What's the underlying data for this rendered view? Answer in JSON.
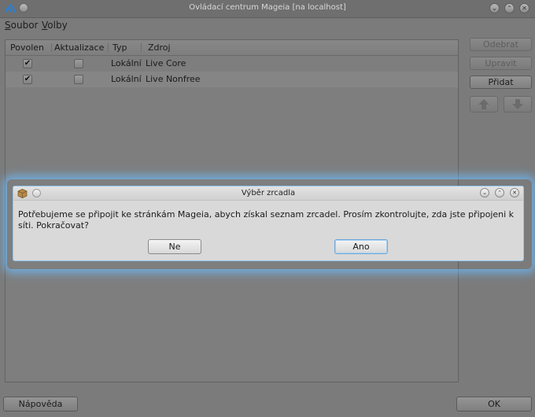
{
  "window": {
    "title": "Ovládací centrum Mageia  [na localhost]"
  },
  "menu": {
    "items": [
      {
        "first": "S",
        "rest": "oubor"
      },
      {
        "first": "V",
        "rest": "olby"
      }
    ]
  },
  "table": {
    "headers": [
      "Povolen",
      "Aktualizace",
      "Typ",
      "Zdroj"
    ],
    "rows": [
      {
        "enabled": true,
        "update": false,
        "type": "Lokální",
        "source": "Live Core"
      },
      {
        "enabled": true,
        "update": false,
        "type": "Lokální",
        "source": "Live Nonfree"
      }
    ]
  },
  "sidebar": {
    "remove_label": "Odebrat",
    "edit_label": "Upravit",
    "add_label": "Přidat"
  },
  "footer": {
    "help_label": "Nápověda",
    "ok_label": "OK"
  },
  "dialog": {
    "title": "Výběr zrcadla",
    "message": "Potřebujeme se připojit ke stránkám Mageia, abych získal seznam zrcadel. Prosím zkontrolujte, zda jste připojeni k síti. Pokračovat?",
    "no_label": "Ne",
    "yes_label": "Ano"
  },
  "icons": {
    "app_logo": "mageia-logo-icon",
    "check": "✔"
  },
  "colors": {
    "dialog_glow": "#6ebeff"
  }
}
